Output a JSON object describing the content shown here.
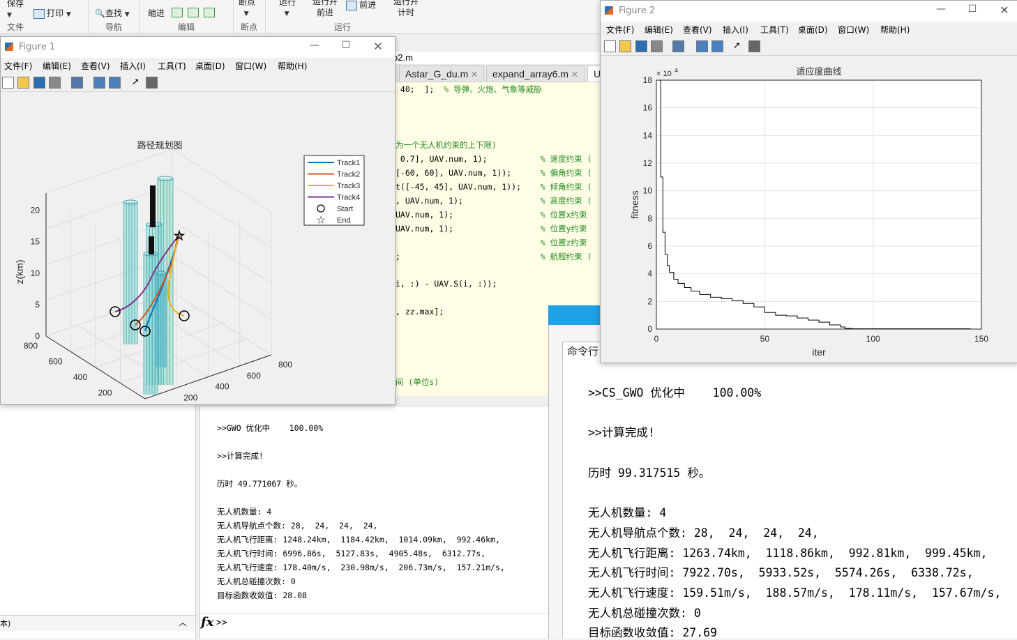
{
  "ribbon": {
    "save": "保存",
    "print": "打印",
    "find": "查找",
    "indent": "缩进",
    "breakpoints": "断点",
    "run": "运行",
    "run_advance_1": "运行并",
    "run_advance_2": "前进",
    "advance": "前进",
    "run_time_1": "运行并",
    "run_time_2": "计时",
    "groups": {
      "file": "文件",
      "navigate": "导航",
      "edit": "编辑",
      "breakpoint": "断点",
      "run": "运行"
    }
  },
  "editor": {
    "breadcrumb_file": "o2.m",
    "tabs": [
      "Astar_G_du.m",
      "expand_array6.m",
      "U"
    ],
    "lines": [
      {
        "code": " 40;  ];  ",
        "comment": "% 导弹、火炮、气象等威胁"
      },
      {
        "code": "",
        "comment": "为一个无人机约束的上下限)"
      },
      {
        "code": " 0.7], UAV.num, 1);           ",
        "comment": "% 速度约束 ("
      },
      {
        "code": "[-60, 60], UAV.num, 1));      ",
        "comment": "% 偏角约束 ("
      },
      {
        "code": "t([-45, 45], UAV.num, 1));    ",
        "comment": "% 倾角约束 ("
      },
      {
        "code": ", UAV.num, 1);                ",
        "comment": "% 高度约束 ("
      },
      {
        "code": "UAV.num, 1);                  ",
        "comment": "% 位置x约束"
      },
      {
        "code": "UAV.num, 1);                  ",
        "comment": "% 位置y约束"
      },
      {
        "code": "                              ",
        "comment": "% 位置z约束"
      },
      {
        "code": ";                             ",
        "comment": "% 航程约束 ("
      },
      {
        "code": "i, :) - UAV.S(i, :));",
        "comment": ""
      },
      {
        "code": ", zz.max];",
        "comment": ""
      },
      {
        "code": "",
        "comment": "间 (单位s)"
      }
    ]
  },
  "figure1": {
    "title": "Figure 1",
    "menu": [
      "文件(F)",
      "编辑(E)",
      "查看(V)",
      "插入(I)",
      "工具(T)",
      "桌面(D)",
      "窗口(W)",
      "帮助(H)"
    ],
    "chart_title": "路径规划图",
    "xlabel": "x(km)",
    "ylabel": "y(km)",
    "zlabel": "z(km)",
    "xticks": [
      "0",
      "200",
      "400",
      "600",
      "800"
    ],
    "yticks": [
      "0",
      "200",
      "400",
      "600",
      "800"
    ],
    "zticks": [
      "0",
      "5",
      "10",
      "15",
      "20"
    ],
    "legend": [
      {
        "label": "Track1",
        "color": "#0072bd",
        "kind": "line"
      },
      {
        "label": "Track2",
        "color": "#d95319",
        "kind": "line"
      },
      {
        "label": "Track3",
        "color": "#edb120",
        "kind": "line"
      },
      {
        "label": "Track4",
        "color": "#7e2f8e",
        "kind": "line"
      },
      {
        "label": "Start",
        "color": "#000000",
        "kind": "circle"
      },
      {
        "label": "End",
        "color": "#000000",
        "kind": "star"
      }
    ]
  },
  "figure2": {
    "title": "Figure 2",
    "menu": [
      "文件(F)",
      "编辑(E)",
      "查看(V)",
      "插入(I)",
      "工具(T)",
      "桌面(D)",
      "窗口(W)",
      "帮助(H)"
    ],
    "chart_title": "适应度曲线",
    "xlabel": "iter",
    "ylabel": "fitness",
    "exponent_base": "× 10",
    "exponent_power": "4"
  },
  "chart_data": {
    "type": "line",
    "title": "适应度曲线",
    "xlabel": "iter",
    "ylabel": "fitness",
    "xlim": [
      0,
      150
    ],
    "ylim": [
      0,
      18
    ],
    "y_scale_note": "× 10^4",
    "xticks": [
      0,
      50,
      100,
      150
    ],
    "yticks": [
      0,
      2,
      4,
      6,
      8,
      10,
      12,
      14,
      16,
      18
    ],
    "grid": true,
    "series": [
      {
        "x": [
          1,
          2,
          3,
          4,
          5,
          6,
          8,
          10,
          13,
          16,
          20,
          25,
          30,
          35,
          40,
          45,
          50,
          55,
          60,
          65,
          70,
          75,
          80,
          85,
          87,
          90,
          100,
          120,
          145
        ],
        "y": [
          18,
          11,
          7,
          5.4,
          4.6,
          4.1,
          3.6,
          3.3,
          3.0,
          2.75,
          2.5,
          2.3,
          2.2,
          2.05,
          1.85,
          1.6,
          1.2,
          1.0,
          0.95,
          0.8,
          0.65,
          0.5,
          0.3,
          0.15,
          0.05,
          0.02,
          0.02,
          0.02,
          0.02
        ]
      }
    ]
  },
  "cmd1": {
    "lines": [
      ">>GWO 优化中    100.00%",
      "",
      ">>计算完成!",
      "",
      "历时 49.771067 秒。",
      "",
      "无人机数量: 4",
      "无人机导航点个数: 28,  24,  24,  24,",
      "无人机飞行距离: 1248.24km,  1184.42km,  1014.09km,  992.46km,",
      "无人机飞行时间: 6996.86s,  5127.83s,  4905.48s,  6312.77s,",
      "无人机飞行速度: 178.40m/s,  230.98m/s,  206.73m/s,  157.21m/s,",
      "无人机总碰撞次数: 0",
      "目标函数收敛值: 28.08"
    ],
    "prompt": ">>"
  },
  "cmd2": {
    "tab": "命令行",
    "lines": [
      ">>CS_GWO 优化中    100.00%",
      "",
      ">>计算完成!",
      "",
      "历时 99.317515 秒。",
      "",
      "无人机数量: 4",
      "无人机导航点个数: 28,  24,  24,  24,",
      "无人机飞行距离: 1263.74km,  1118.86km,  992.81km,  999.45km,",
      "无人机飞行时间: 7922.70s,  5933.52s,  5574.26s,  6338.72s,",
      "无人机飞行速度: 159.51m/s,  188.57m/s,  178.11m/s,  157.67m/s,",
      "无人机总碰撞次数: 0",
      "目标函数收敛值: 27.69"
    ]
  },
  "left_status": "本)"
}
